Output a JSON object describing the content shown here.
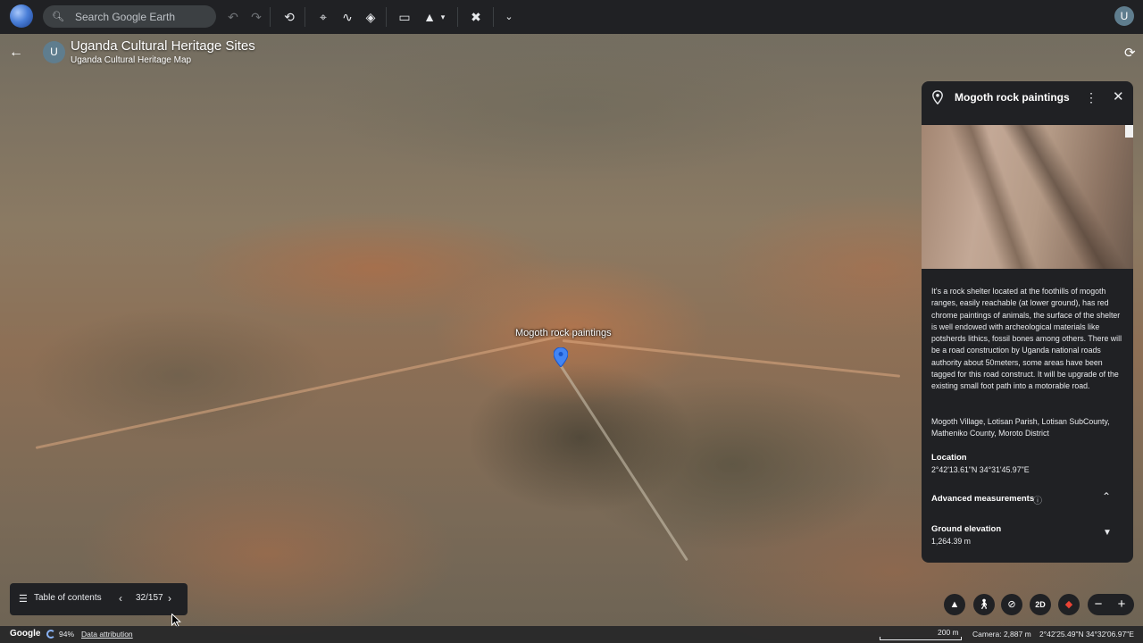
{
  "toolbar": {
    "search_placeholder": "Search Google Earth",
    "icons": [
      "undo-icon",
      "redo-icon",
      "history-icon",
      "placemark-icon",
      "path-icon",
      "layers-icon",
      "measure-icon",
      "image-overlay-icon",
      "tools-icon",
      "expand-icon"
    ],
    "user_initial": "U"
  },
  "project": {
    "initial": "U",
    "title": "Uganda Cultural Heritage Sites",
    "subtitle": "Uganda Cultural Heritage Map"
  },
  "placemark": {
    "label": "Mogoth rock paintings",
    "color": "#4285f4"
  },
  "panel": {
    "title": "Mogoth rock paintings",
    "description": "It's a rock shelter located at the foothills of mogoth ranges, easily reachable (at lower ground), has red chrome paintings of animals, the surface of the shelter is well endowed with archeological materials like potsherds lithics, fossil bones among others. There will be a road construction by Uganda national roads authority about 50meters, some areas have been tagged for this road construct. It will be upgrade of the existing small foot path into a motorable road.",
    "address": "Mogoth Village, Lotisan Parish, Lotisan SubCounty, Matheniko County, Moroto District",
    "location_label": "Location",
    "location_value": "2°42'13.61\"N 34°31'45.97\"E",
    "advanced_label": "Advanced measurements",
    "elevation_label": "Ground elevation",
    "elevation_value": "1,264.39 m"
  },
  "toc": {
    "label": "Table of contents",
    "count": "32/157"
  },
  "controls": {
    "view_2d": "2D",
    "zoom_out": "−",
    "zoom_in": "+"
  },
  "status": {
    "brand": "Google",
    "loading": "94%",
    "attribution": "Data attribution",
    "scale": "200 m",
    "camera": "Camera: 2,887 m",
    "coordinates": "2°42'25.49\"N 34°32'06.97\"E"
  }
}
